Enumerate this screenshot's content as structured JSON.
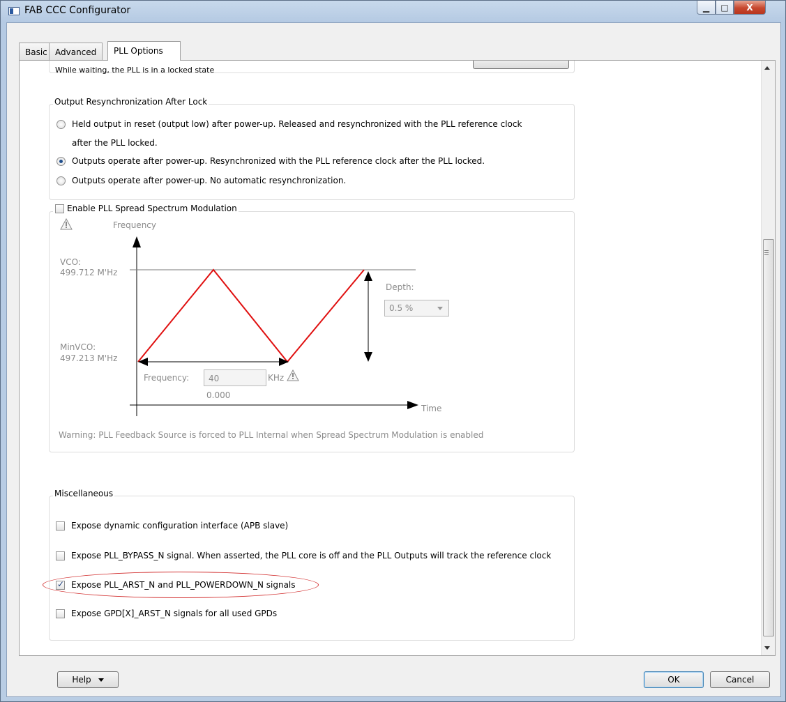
{
  "window": {
    "title": "FAB CCC Configurator",
    "controls": {
      "minimize": "▁",
      "maximize": "□",
      "close": "X"
    }
  },
  "tabs": [
    {
      "label": "Basic",
      "active": false
    },
    {
      "label": "Advanced",
      "active": false
    },
    {
      "label": "PLL Options",
      "active": true
    }
  ],
  "lock": {
    "partial_text": "While waiting, the PLL is in a locked state"
  },
  "resync": {
    "title": "Output Resynchronization After Lock",
    "options": [
      {
        "line1": "Held output in reset (output low) after power-up. Released and resynchronized with the PLL reference clock",
        "line2": "after the PLL locked.",
        "checked": false
      },
      {
        "line1": "Outputs operate after power-up. Resynchronized with the PLL reference clock after the PLL locked.",
        "checked": true
      },
      {
        "line1": "Outputs operate after power-up. No automatic resynchronization.",
        "checked": false
      }
    ]
  },
  "spread": {
    "title": "Enable PLL Spread Spectrum Modulation",
    "checked": false,
    "y_axis_label": "Frequency",
    "x_axis_label": "Time",
    "vco_label": "VCO:",
    "vco_value": "499.712  M'Hz",
    "minvco_label": "MinVCO:",
    "minvco_value": "497.213  M'Hz",
    "depth_label": "Depth:",
    "depth_value": "0.5 %",
    "frequency_label": "Frequency:",
    "frequency_value": "40",
    "frequency_unit": "KHz",
    "frequency_readout": "0.000",
    "warning": "Warning: PLL Feedback Source is forced to PLL Internal when Spread Spectrum Modulation is enabled",
    "wave_color": "#e01010"
  },
  "misc": {
    "title": "Miscellaneous",
    "options": [
      {
        "label": "Expose dynamic configuration interface (APB slave)",
        "checked": false
      },
      {
        "label": "Expose PLL_BYPASS_N signal. When asserted, the PLL core is off and the PLL Outputs will track the reference clock",
        "checked": false
      },
      {
        "label": "Expose PLL_ARST_N and PLL_POWERDOWN_N signals",
        "checked": true
      },
      {
        "label": "Expose GPD[X]_ARST_N signals for all used GPDs",
        "checked": false
      }
    ],
    "highlight_color": "#d23030"
  },
  "footer": {
    "help_label": "Help",
    "ok_label": "OK",
    "cancel_label": "Cancel"
  }
}
